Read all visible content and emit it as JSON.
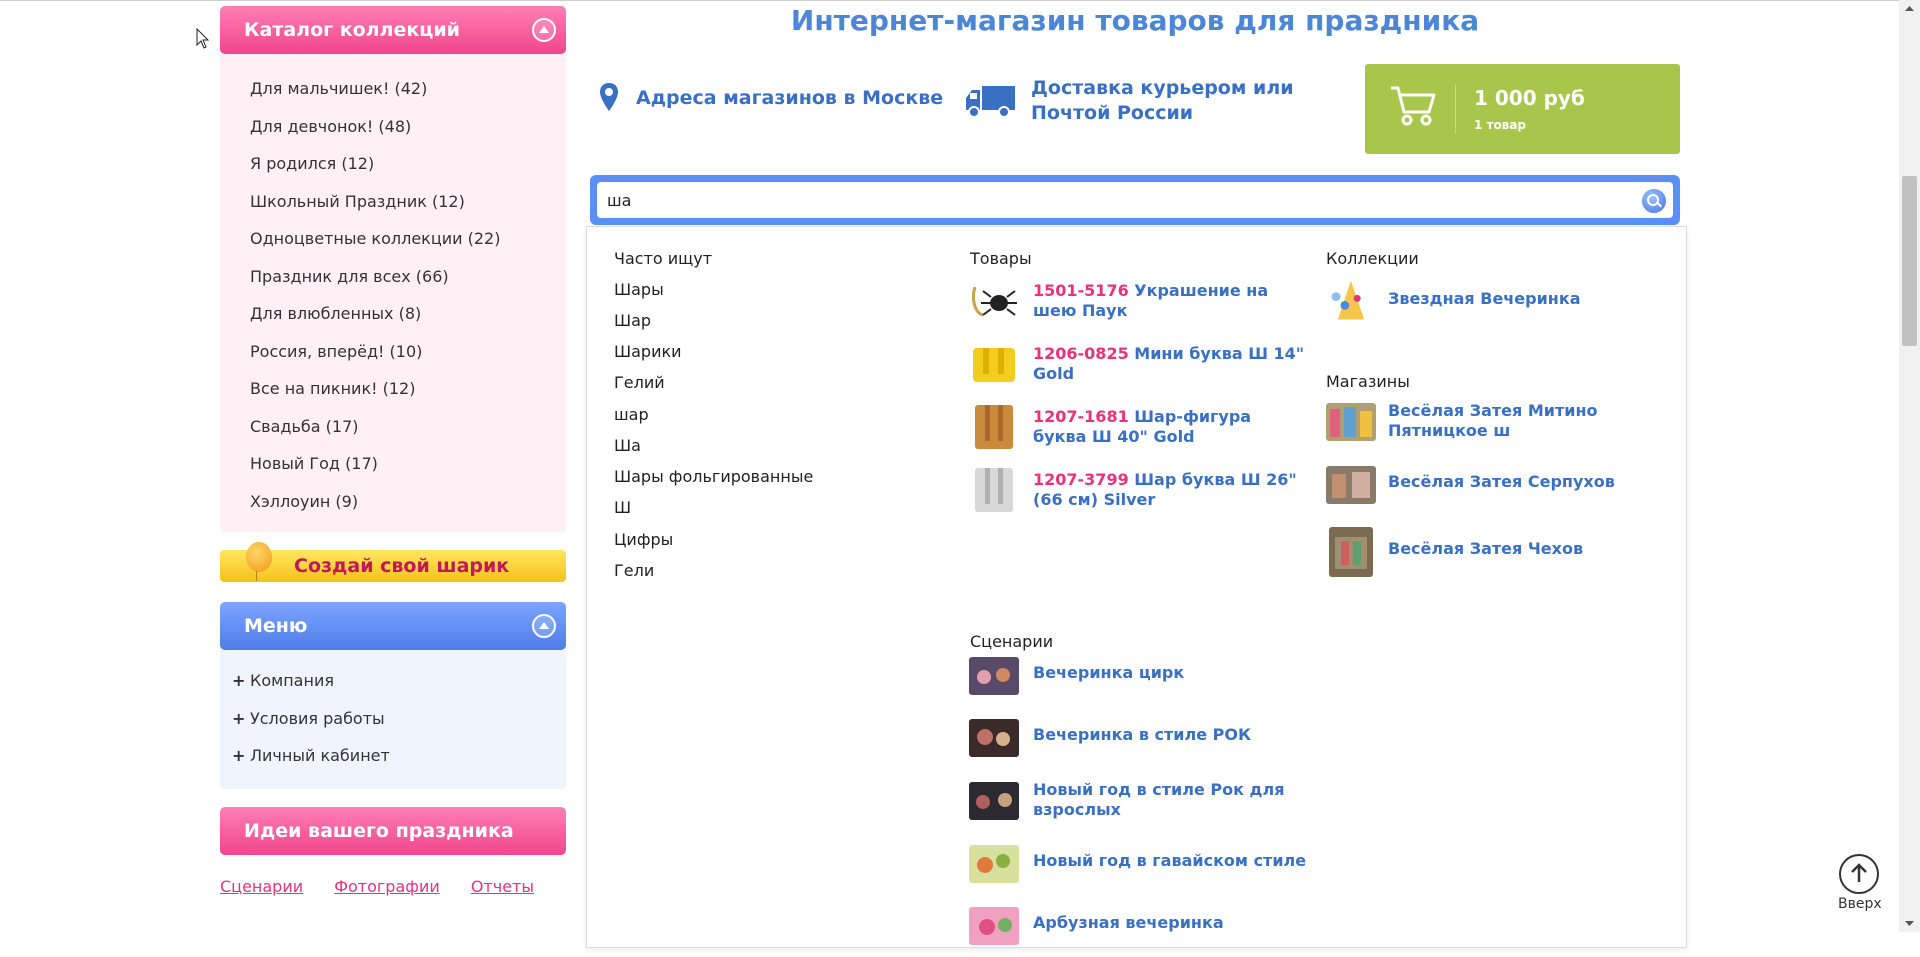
{
  "site": {
    "title": "Интернет-магазин товаров для праздника"
  },
  "header": {
    "stores_link": "Адреса магазинов в Москве",
    "delivery_link_line1": "Доставка курьером или",
    "delivery_link_line2": "Почтой России",
    "cart_price": "1 000 руб",
    "cart_count": "1 товар"
  },
  "catalog": {
    "title": "Каталог коллекций",
    "items": [
      "Для мальчишек! (42)",
      "Для девчонок! (48)",
      "Я родился (12)",
      "Школьный Праздник (12)",
      "Одноцветные коллекции (22)",
      "Праздник для всех (66)",
      "Для влюбленных (8)",
      "Россия, вперёд! (10)",
      "Все на пикник! (12)",
      "Свадьба (17)",
      "Новый Год (17)",
      "Хэллоуин (9)"
    ]
  },
  "balloon_banner": "Создай свой шарик",
  "menu": {
    "title": "Меню",
    "items": [
      "Компания",
      "Условия работы",
      "Личный кабинет"
    ],
    "plus": "+"
  },
  "ideas": {
    "title": "Идеи вашего праздника",
    "links": [
      "Сценарии",
      "Фотографии",
      "Отчеты"
    ]
  },
  "search": {
    "value": "ша"
  },
  "dropdown": {
    "frequent_title": "Часто ищут",
    "frequent": [
      "Шары",
      "Шар",
      "Шарики",
      "Гелий",
      "шар",
      "Ша",
      "Шары фольгированные",
      "Ш",
      "Цифры",
      "Гели"
    ],
    "products_title": "Товары",
    "products": [
      {
        "sku": "1501-5176",
        "name": "Украшение на шею Паук"
      },
      {
        "sku": "1206-0825",
        "name": "Мини буква Ш 14\" Gold"
      },
      {
        "sku": "1207-1681",
        "name": "Шар-фигура буква Ш 40\" Gold"
      },
      {
        "sku": "1207-3799",
        "name": "Шар буква Ш 26\" (66 см) Silver"
      }
    ],
    "collections_title": "Коллекции",
    "collections": [
      "Звездная Вечеринка"
    ],
    "shops_title": "Магазины",
    "shops": [
      "Весёлая Затея Митино Пятницкое ш",
      "Весёлая Затея Серпухов",
      "Весёлая Затея Чехов"
    ],
    "scenarios_title": "Сценарии",
    "scenarios": [
      "Вечеринка цирк",
      "Вечеринка в стиле РОК",
      "Новый год в стиле Рок для взрослых",
      "Новый год в гавайском стиле",
      "Арбузная вечеринка"
    ]
  },
  "to_top": "Вверх",
  "colors": {
    "pink": "#f0458c",
    "blue": "#4f7ee8",
    "cart_green": "#a8c54c",
    "link_blue": "#3a70c4",
    "sku_pink": "#e8327c"
  }
}
